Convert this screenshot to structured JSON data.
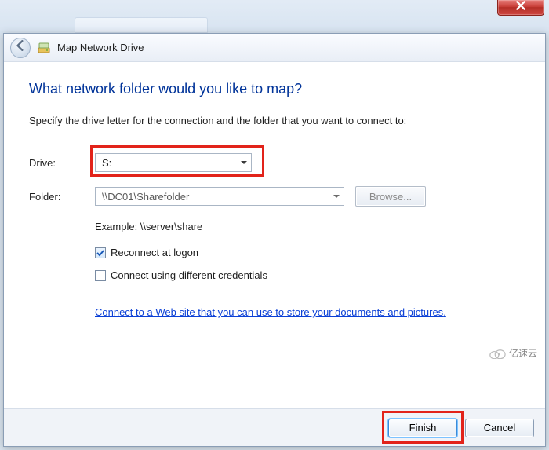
{
  "window": {
    "title": "Map Network Drive"
  },
  "heading": "What network folder would you like to map?",
  "subtext": "Specify the drive letter for the connection and the folder that you want to connect to:",
  "labels": {
    "drive": "Drive:",
    "folder": "Folder:"
  },
  "drive": {
    "value": "S:"
  },
  "folder": {
    "value": "\\\\DC01\\Sharefolder"
  },
  "buttons": {
    "browse": "Browse...",
    "finish": "Finish",
    "cancel": "Cancel"
  },
  "example": "Example: \\\\server\\share",
  "checks": {
    "reconnect": {
      "label": "Reconnect at logon",
      "checked": true
    },
    "diffcred": {
      "label": "Connect using different credentials",
      "checked": false
    }
  },
  "link": "Connect to a Web site that you can use to store your documents and pictures",
  "watermark": "亿速云"
}
